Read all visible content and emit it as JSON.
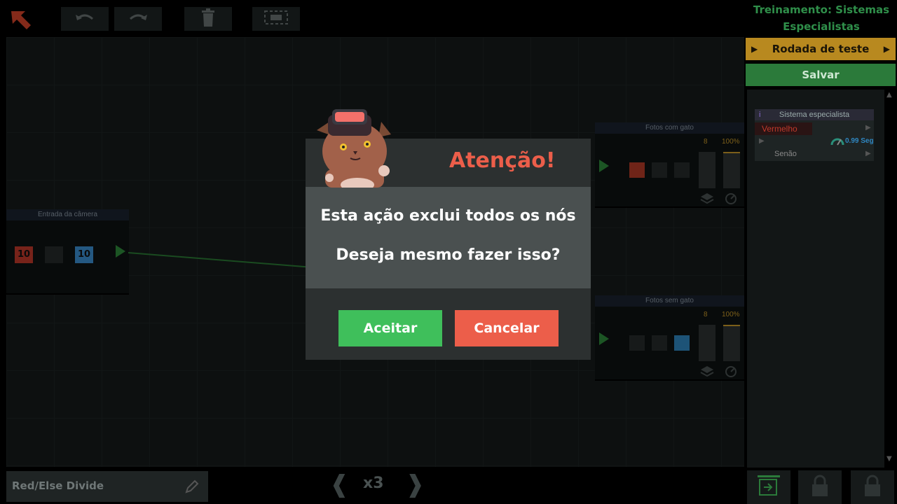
{
  "toolbar": {
    "back_icon": "back-arrow-icon",
    "undo_icon": "undo-icon",
    "redo_icon": "redo-icon",
    "delete_icon": "trash-icon",
    "arrange_icon": "fit-view-icon"
  },
  "canvas": {
    "nodes": [
      {
        "title": "Entrada da câmera",
        "values": [
          "10",
          "10"
        ]
      },
      {
        "title": "Fotos com gato",
        "count": "8",
        "percent": "100%"
      },
      {
        "title": "Fotos sem gato",
        "count": "8",
        "percent": "100%"
      }
    ]
  },
  "panel": {
    "title": "Treinamento: Sistemas Especialistas",
    "test_run_label": "Rodada de teste",
    "save_label": "Salvar",
    "card": {
      "title": "Sistema especialista",
      "info": "i",
      "row1": "Vermelho",
      "speed": "0.99 Seg",
      "row3": "Senão"
    }
  },
  "bottom": {
    "program_name": "Red/Else Divide",
    "speed_label": "x3"
  },
  "modal": {
    "title": "Atenção!",
    "line1": "Esta ação exclui todos os nós",
    "line2": "Deseja mesmo fazer isso?",
    "accept_label": "Aceitar",
    "cancel_label": "Cancelar"
  },
  "colors": {
    "accent_green": "#3fbf5b",
    "accent_red": "#ec5e4a",
    "accent_gold": "#b8891f"
  }
}
